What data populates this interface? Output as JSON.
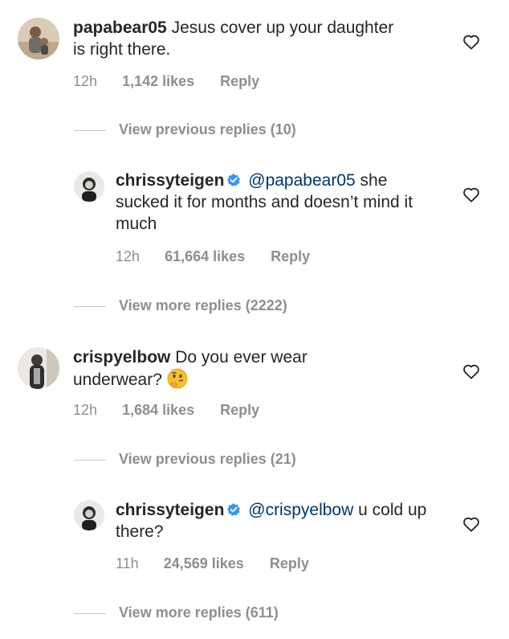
{
  "comments": [
    {
      "username": "papabear05",
      "text": "Jesus cover up your daughter is right there.",
      "time": "12h",
      "likes": "1,142 likes",
      "reply": "Reply",
      "avatar_icon": "user-avatar-photo"
    },
    {
      "view_link": "View previous replies (10)"
    },
    {
      "username": "chrissyteigen",
      "verified": true,
      "mention": "@papabear05",
      "text": "she sucked it for months and doesn’t mind it much",
      "time": "12h",
      "likes": "61,664 likes",
      "reply": "Reply"
    },
    {
      "view_link": "View more replies (2222)"
    },
    {
      "username": "crispyelbow",
      "text": "Do you ever wear underwear?",
      "emoji": "thinking-face-emoji",
      "time": "12h",
      "likes": "1,684 likes",
      "reply": "Reply"
    },
    {
      "view_link": "View previous replies (21)"
    },
    {
      "username": "chrissyteigen",
      "verified": true,
      "mention": "@crispyelbow",
      "text": "u cold up there?",
      "time": "11h",
      "likes": "24,569 likes",
      "reply": "Reply"
    },
    {
      "view_link": "View more replies (611)"
    }
  ],
  "colors": {
    "text": "#262626",
    "meta": "#8e8e8e",
    "mention": "#003569",
    "verified": "#3897f0"
  }
}
